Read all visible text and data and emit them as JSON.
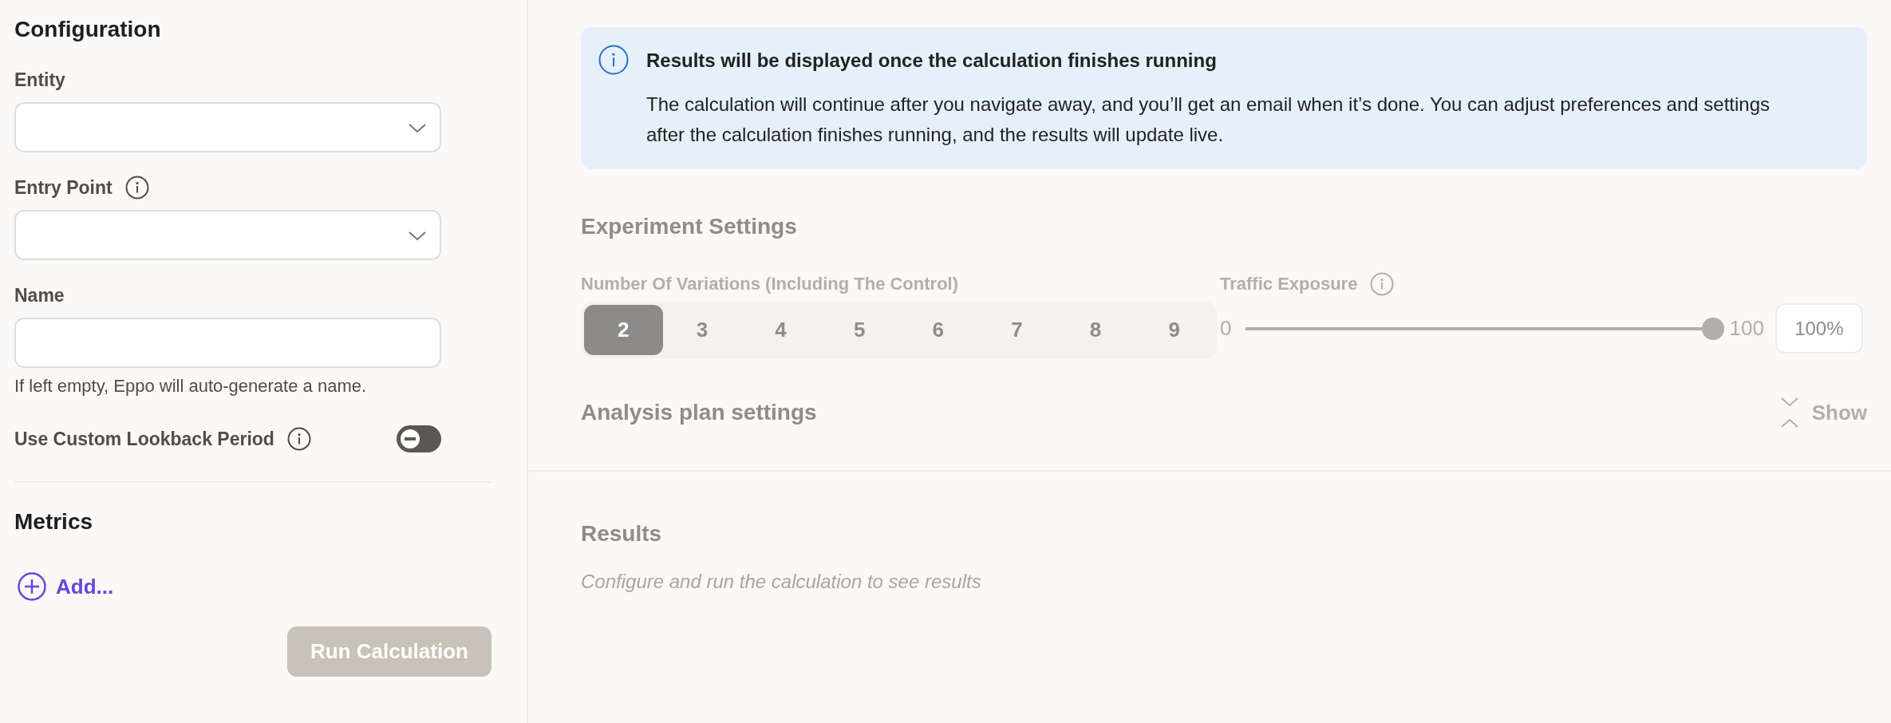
{
  "configuration": {
    "title": "Configuration",
    "fields": [
      {
        "kind": "select",
        "label": "Entity",
        "info": false
      },
      {
        "kind": "select",
        "label": "Entry Point",
        "info": true
      },
      {
        "kind": "text",
        "label": "Name",
        "info": false,
        "helper": "If left empty, Eppo will auto-generate a name."
      }
    ],
    "lookback": {
      "label": "Use Custom Lookback Period",
      "info": true,
      "on": false
    }
  },
  "metrics": {
    "title": "Metrics",
    "add_link": "Add..."
  },
  "run_button": {
    "label": "Run Calculation",
    "disabled": true
  },
  "alert": {
    "title": "Results will be displayed once the calculation finishes running",
    "body": "The calculation will continue after you navigate away, and you’ll get an email when it’s done. You can adjust preferences and settings after the calculation finishes running, and the results will update live."
  },
  "experiment_settings": {
    "title": "Experiment Settings",
    "variations": {
      "label": "Number Of Variations (Including The Control)",
      "options": [
        {
          "label": "2",
          "selected": true
        },
        {
          "label": "3",
          "selected": false
        },
        {
          "label": "4",
          "selected": false
        },
        {
          "label": "5",
          "selected": false
        },
        {
          "label": "6",
          "selected": false
        },
        {
          "label": "7",
          "selected": false
        },
        {
          "label": "8",
          "selected": false
        },
        {
          "label": "9",
          "selected": false
        }
      ]
    },
    "traffic_exposure": {
      "label": "Traffic Exposure",
      "min": "0",
      "max": "100",
      "level": 1,
      "value": "100%"
    }
  },
  "analysis_plan": {
    "title": "Analysis plan settings",
    "toggle": "Show",
    "expanded": false
  },
  "results": {
    "title": "Results",
    "empty_text": "Configure and run the calculation to see results"
  }
}
